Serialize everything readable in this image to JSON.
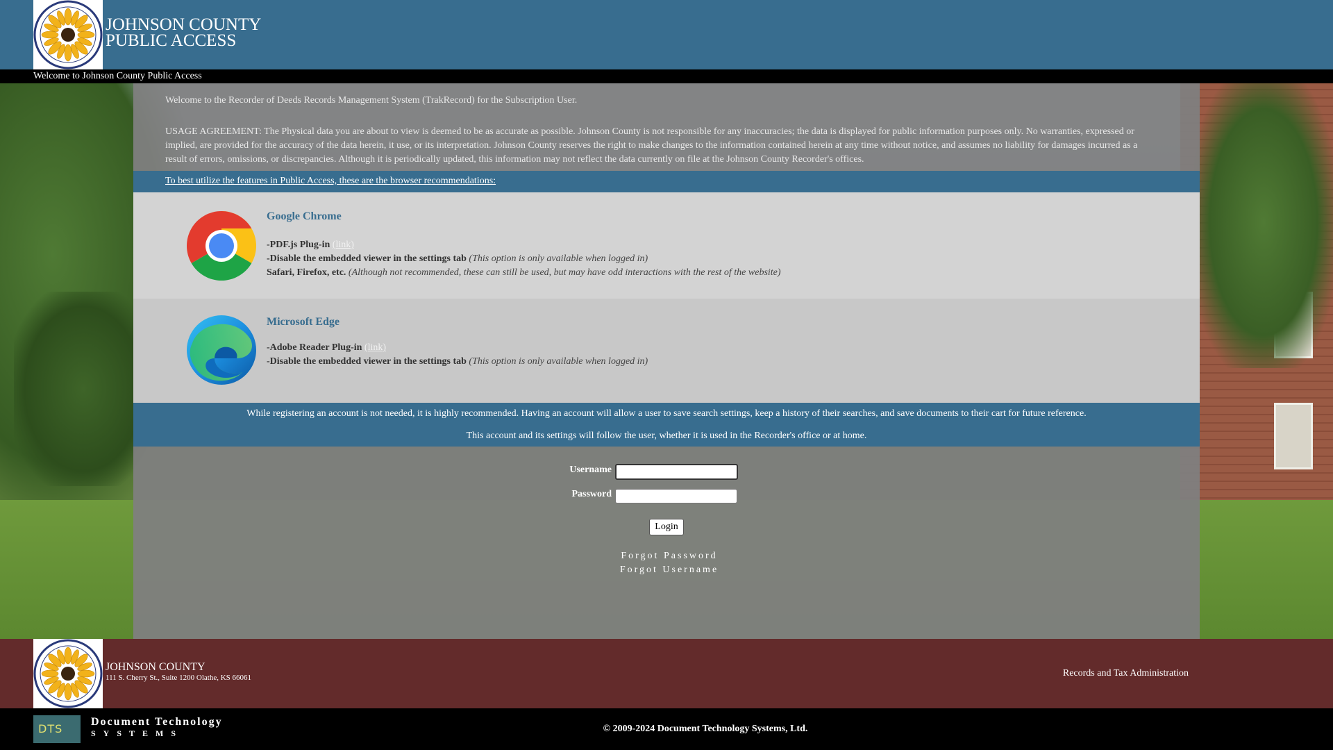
{
  "header": {
    "title_line1": "JOHNSON COUNTY",
    "title_line2": "PUBLIC ACCESS",
    "welcome": "Welcome to Johnson County Public Access"
  },
  "intro": {
    "welcome_text": "Welcome to the Recorder of Deeds Records Management System (TrakRecord) for the Subscription User.",
    "usage_agreement": "USAGE AGREEMENT: The Physical data you are about to view is deemed to be as accurate as possible. Johnson County is not responsible for any inaccuracies; the data is displayed for public information purposes only. No warranties, expressed or implied, are provided for the accuracy of the data herein, it use, or its interpretation. Johnson County reserves the right to make changes to the information contained herein at any time without notice, and assumes no liability for damages incurred as a result of errors, omissions, or discrepancies. Although it is periodically updated, this information may not reflect the data currently on file at the Johnson County Recorder's offices."
  },
  "recommendations_link": "To best utilize the features in Public Access, these are the browser recommendations:",
  "chrome": {
    "name": "Google Chrome",
    "line1_bold": "-PDF.js Plug-in",
    "line1_link": "(link)",
    "line2_bold": "-Disable the embedded viewer in the settings tab",
    "line2_note": "(This option is only available when logged in)",
    "line3_bold": "Safari, Firefox, etc.",
    "line3_note": "(Although not recommended, these can still be used, but may have odd interactions with the rest of the website)"
  },
  "edge": {
    "name": "Microsoft Edge",
    "line1_bold": "-Adobe Reader Plug-in",
    "line1_link": "(link)",
    "line2_bold": "-Disable the embedded viewer in the settings tab",
    "line2_note": "(This option is only available when logged in)"
  },
  "registration": {
    "line1": "While registering an account is not needed, it is highly recommended. Having an account will allow a user to save search settings, keep a history of their searches, and save documents to their cart for future reference.",
    "line2": "This account and its settings will follow the user, whether it is used in the Recorder's office or at home."
  },
  "login": {
    "username_label": "Username",
    "username_value": "",
    "password_label": "Password",
    "password_value": "",
    "login_button": "Login",
    "forgot_password": "Forgot Password",
    "forgot_username": "Forgot Username"
  },
  "footer": {
    "county": "JOHNSON COUNTY",
    "address": "111 S. Cherry St., Suite 1200 Olathe, KS 66061",
    "department": "Records and Tax Administration"
  },
  "bottom": {
    "dts_logo_text": "DTS",
    "company_line1": "Document Technology",
    "company_line2": "SYSTEMS",
    "copyright": "© 2009-2024 Document Technology Systems, Ltd."
  },
  "colors": {
    "header_blue": "#386d8f",
    "footer_maroon": "#632b2b",
    "panel_gray": "#808080"
  },
  "icons": [
    "county-seal-icon",
    "chrome-icon",
    "edge-icon",
    "dts-logo-icon"
  ]
}
